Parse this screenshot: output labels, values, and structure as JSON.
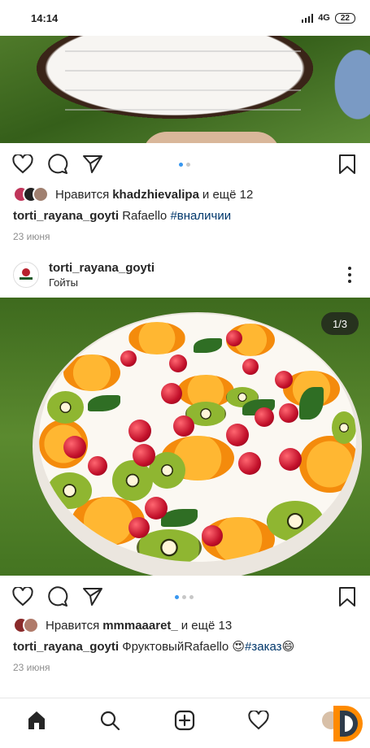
{
  "status_bar": {
    "time": "14:14",
    "network": "4G",
    "battery": "22"
  },
  "post1": {
    "likes": {
      "prefix": "Нравится",
      "user": "khadzhievalipa",
      "suffix": "и ещё 12"
    },
    "caption": {
      "username": "torti_rayana_goyti",
      "text": "Rafaello",
      "hashtag": "#вналичии"
    },
    "date": "23 июня"
  },
  "post2": {
    "header": {
      "username": "torti_rayana_goyti",
      "location": "Гойты"
    },
    "counter": "1/3",
    "likes": {
      "prefix": "Нравится",
      "user": "mmmaaaret_",
      "suffix": "и ещё 13"
    },
    "caption": {
      "username": "torti_rayana_goyti",
      "text": "ФруктовыйRafaello 😍",
      "hashtag": "#заказ",
      "emoji_end": "😄"
    },
    "date": "23 июня"
  },
  "icons": {
    "like": "heart-icon",
    "comment": "comment-icon",
    "share": "send-icon",
    "save": "bookmark-icon",
    "nav": [
      "home-icon",
      "search-icon",
      "new-post-icon",
      "activity-icon",
      "profile-icon"
    ]
  },
  "colors": {
    "accent_blue": "#3897f0",
    "hashtag": "#00376b",
    "text": "#262626",
    "muted": "#8e8e8e"
  }
}
